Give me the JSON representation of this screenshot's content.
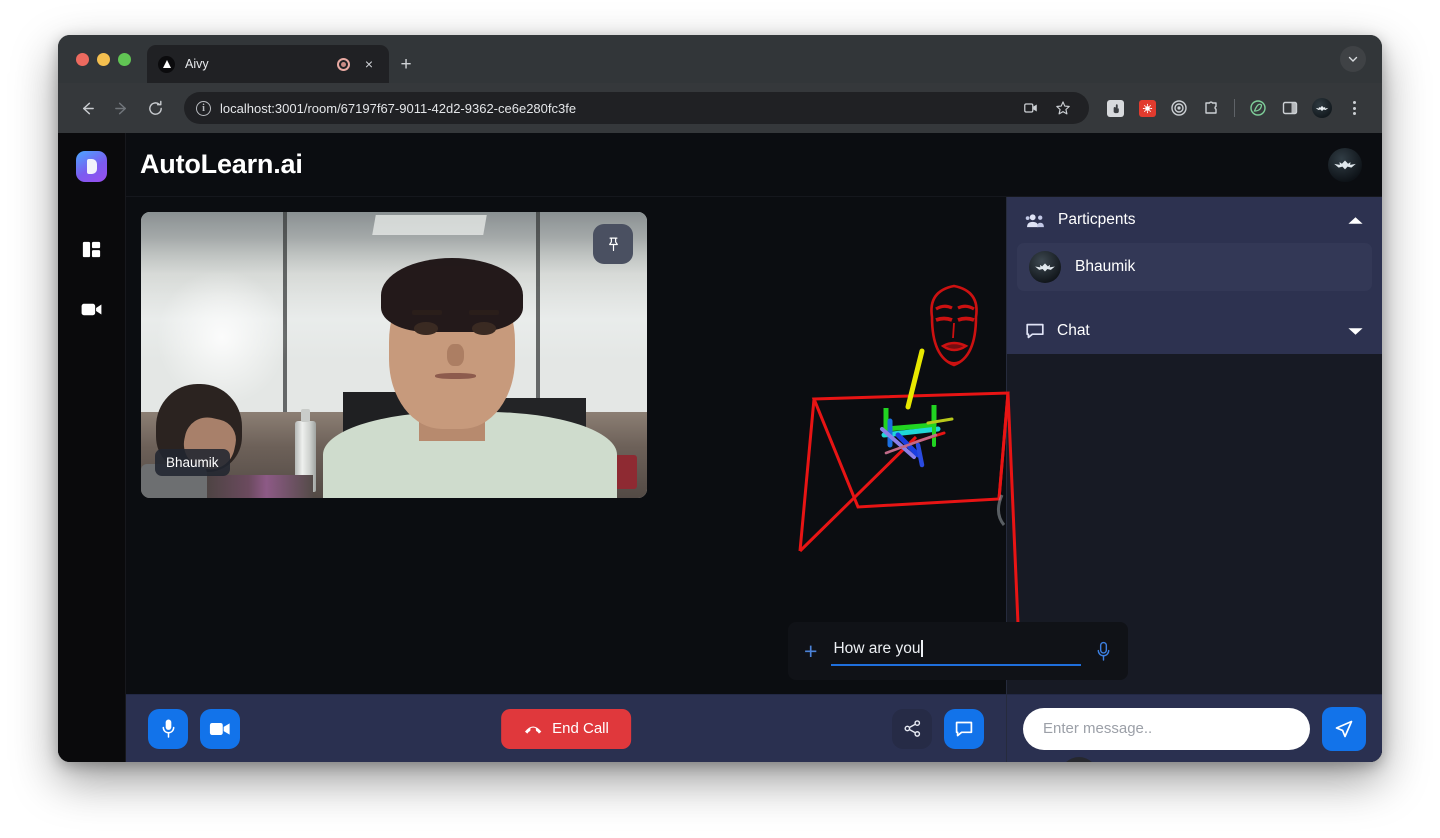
{
  "browser": {
    "tab": {
      "title": "Aivy",
      "favicon": "triangle-play-icon",
      "recording_indicator": "record-circle-icon",
      "close": "×"
    },
    "new_tab": "+",
    "tab_list_chevron": "chevron-down-icon",
    "nav": {
      "back": "back-arrow-icon",
      "forward": "forward-arrow-icon",
      "reload": "reload-icon"
    },
    "omnibox": {
      "site_info": "info-icon",
      "url": "localhost:3001/room/67197f67-9011-42d2-9362-ce6e280fc3fe",
      "media_cast": "screencast-icon",
      "bookmark": "star-icon"
    },
    "extensions": [
      {
        "name": "extension-white-icon",
        "glyph": ""
      },
      {
        "name": "extension-red-icon",
        "glyph": ""
      },
      {
        "name": "extension-target-icon",
        "glyph": ""
      },
      {
        "name": "extensions-puzzle-icon",
        "glyph": ""
      },
      {
        "name": "extension-leaf-icon",
        "glyph": ""
      },
      {
        "name": "side-panel-icon",
        "glyph": ""
      }
    ],
    "profile_avatar": "profile-avatar-icon",
    "menu": "three-dot-menu-icon"
  },
  "app": {
    "title": "AutoLearn.ai",
    "logo": "autolearn-logo-icon",
    "header_avatar": "user-avatar-icon",
    "rail": [
      {
        "name": "sidebar-item-dashboard",
        "icon": "layout-panel-icon"
      },
      {
        "name": "sidebar-item-video",
        "icon": "video-camera-icon"
      }
    ]
  },
  "stage": {
    "video_tile": {
      "participant_name": "Bhaumik",
      "pin_icon": "pin-icon"
    },
    "pose": {
      "control_icon": "pose-target-icon"
    },
    "ai_input": {
      "add_icon": "plus-icon",
      "value": "How are you",
      "mic_icon": "microphone-icon"
    }
  },
  "controls": {
    "mic": {
      "label": "microphone-icon"
    },
    "camera": {
      "label": "video-camera-icon"
    },
    "end_call": {
      "label": "End Call",
      "icon": "phone-hangup-icon",
      "color": "#e0383c"
    },
    "share": {
      "label": "share-icon"
    },
    "chat": {
      "label": "chat-bubble-icon"
    }
  },
  "panel": {
    "participants": {
      "label": "Particpents",
      "icon": "people-icon",
      "caret": "chevron-up-icon",
      "expanded": true,
      "items": [
        {
          "name": "Bhaumik",
          "avatar": "user-avatar-icon"
        }
      ]
    },
    "chat": {
      "label": "Chat",
      "icon": "chat-bubble-icon",
      "caret": "chevron-down-icon",
      "expanded": false,
      "input_placeholder": "Enter message..",
      "send_icon": "send-icon"
    }
  },
  "colors": {
    "accent_blue": "#1273ea",
    "danger_red": "#e0383c",
    "panel_navy": "#2d3250",
    "bar_navy": "#2a3050",
    "app_bg": "#0b0d11"
  }
}
